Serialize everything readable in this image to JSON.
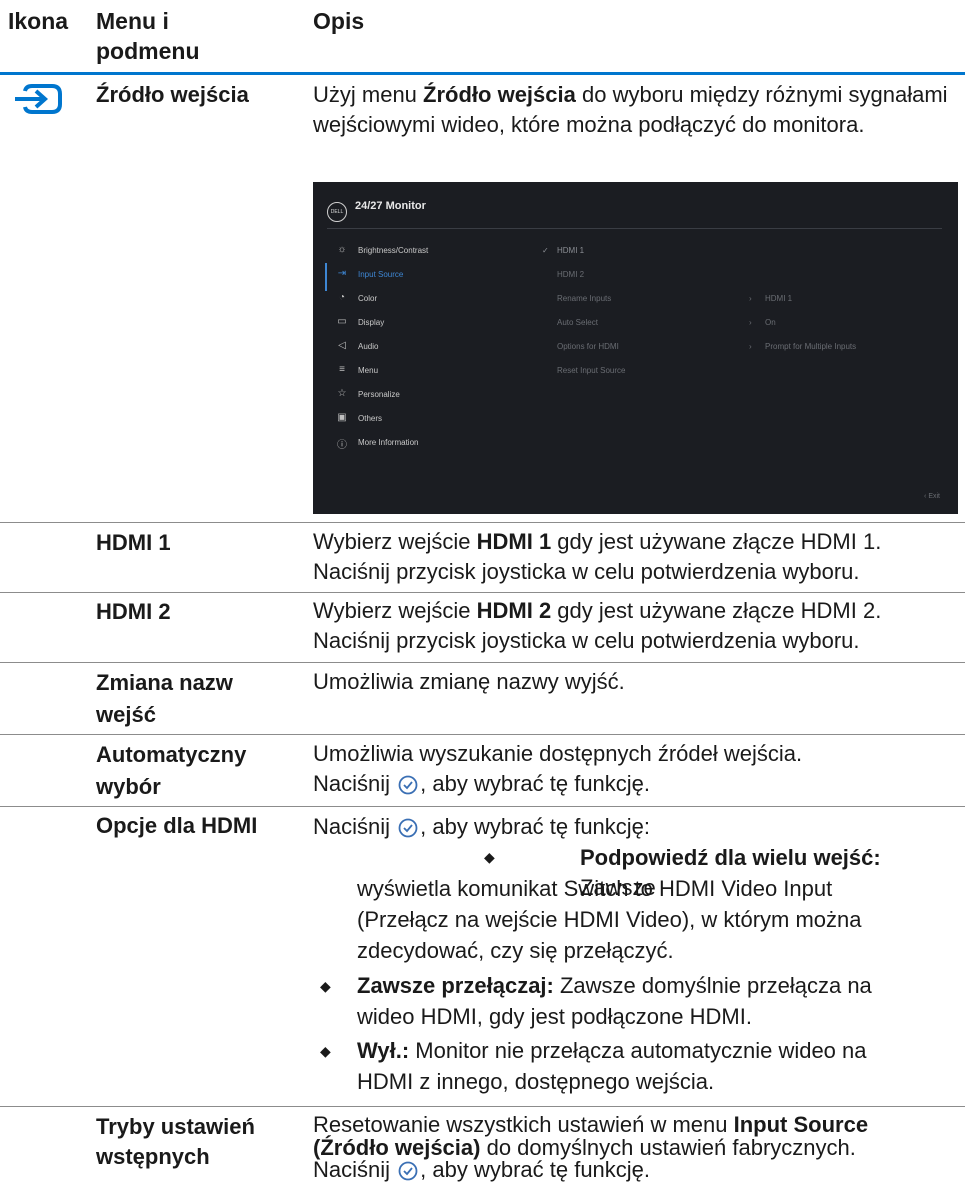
{
  "header": {
    "col1": "Ikona",
    "col2_line1": "Menu i",
    "col2_line2": "podmenu",
    "col3": "Opis"
  },
  "source": {
    "label": "Źródło wejścia",
    "desc_pre": "Użyj menu ",
    "desc_bold": "Źródło wejścia",
    "desc_post": " do wyboru między różnymi sygnałami wejściowymi wideo, które można podłączyć do monitora."
  },
  "osd": {
    "title": "24/27 Monitor",
    "logo": "DELL",
    "menu": [
      "Brightness/Contrast",
      "Input Source",
      "Color",
      "Display",
      "Audio",
      "Menu",
      "Personalize",
      "Others",
      "More Information"
    ],
    "submenu": [
      "HDMI 1",
      "HDMI 2",
      "Rename Inputs",
      "Auto Select",
      "Options for HDMI",
      "Reset Input Source"
    ],
    "values": [
      "HDMI 1",
      "On",
      "Prompt for Multiple Inputs"
    ],
    "exit": "Exit"
  },
  "rows": {
    "hdmi1": {
      "label": "HDMI 1",
      "pre": "Wybierz wejście ",
      "bold": "HDMI 1",
      "post": " gdy jest używane złącze HDMI 1. Naciśnij przycisk joysticka w celu potwierdzenia wyboru."
    },
    "hdmi2": {
      "label": "HDMI 2",
      "pre": "Wybierz wejście ",
      "bold": "HDMI 2",
      "post": " gdy jest używane złącze HDMI 2. Naciśnij przycisk joysticka w celu potwierdzenia wyboru."
    },
    "rename": {
      "label_l1": "Zmiana nazw",
      "label_l2": "wejść",
      "desc": "Umożliwia zmianę nazwy wyjść."
    },
    "auto": {
      "label_l1": "Automatyczny",
      "label_l2": "wybór",
      "desc_l1": "Umożliwia wyszukanie dostępnych źródeł wejścia.",
      "desc_pre": "Naciśnij ",
      "desc_post": ", aby wybrać tę funkcję."
    },
    "hdmi_opts": {
      "label": "Opcje dla HDMI",
      "intro_pre": "Naciśnij ",
      "intro_post": ", aby wybrać tę funkcję:",
      "b1_bold": "Podpowiedź dla wielu wejść:",
      "b1_l1": " Zawsze",
      "b1_l2": "wyświetla komunikat Switch to HDMI Video Input",
      "b1_l3": "(Przełącz na wejście HDMI Video), w którym można",
      "b1_l4": "zdecydować, czy się przełączyć.",
      "b2_bold": "Zawsze przełączaj:",
      "b2_l1": " Zawsze domyślnie przełącza na",
      "b2_l2": "wideo HDMI, gdy jest podłączone HDMI.",
      "b3_bold": "Wył.:",
      "b3_l1": " Monitor nie przełącza automatycznie wideo na",
      "b3_l2": "HDMI z innego, dostępnego wejścia."
    },
    "reset": {
      "label_l1": "Tryby ustawień",
      "label_l2": "wstępnych",
      "l1_pre": "Resetowanie wszystkich ustawień w menu ",
      "l1_bold": "Input Source",
      "l2_bold": "(Źródło wejścia)",
      "l2_post": " do domyślnych ustawień fabrycznych.",
      "l3_pre": "Naciśnij ",
      "l3_post": ", aby wybrać tę funkcję."
    }
  },
  "colors": {
    "accent": "#0076ce",
    "osd_bg": "#1b1d22",
    "osd_active": "#3e87d4"
  }
}
